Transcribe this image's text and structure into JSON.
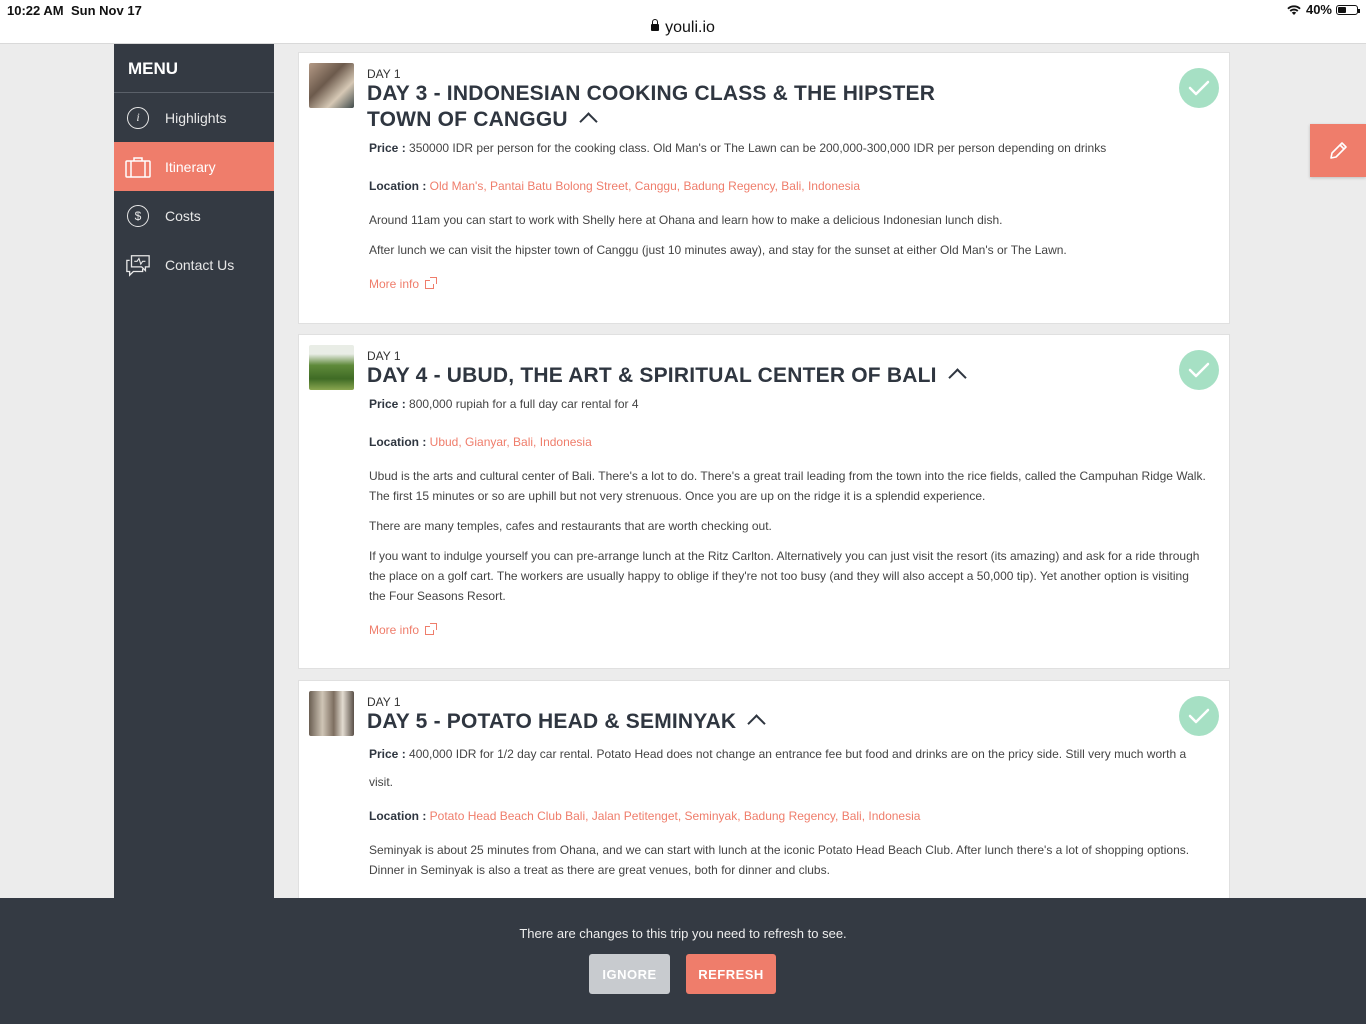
{
  "status": {
    "time": "10:22 AM",
    "date": "Sun Nov 17",
    "url": "youli.io",
    "battery": "40%"
  },
  "menu": {
    "title": "MENU",
    "items": [
      {
        "label": "Highlights",
        "icon": "info-icon"
      },
      {
        "label": "Itinerary",
        "icon": "suitcase-icon",
        "active": true
      },
      {
        "label": "Costs",
        "icon": "dollar-icon"
      },
      {
        "label": "Contact Us",
        "icon": "chat-icon"
      }
    ]
  },
  "cards": [
    {
      "day": "DAY 1",
      "title_line1": "DAY 3 - INDONESIAN COOKING CLASS & THE HIPSTER",
      "title_line2": "TOWN OF CANGGU",
      "price_label": "Price :",
      "price": "350000 IDR per person for the cooking class. Old Man's or The Lawn can be 200,000-300,000 IDR per person depending on drinks",
      "location_label": "Location :",
      "location": "Old Man's, Pantai Batu Bolong Street, Canggu, Badung Regency, Bali, Indonesia",
      "paragraphs": [
        "Around 11am you can start to work with Shelly here at Ohana and learn how to make a delicious Indonesian lunch dish.",
        "After lunch we can visit the hipster town of Canggu (just 10 minutes away), and stay for the sunset at either Old Man's or The Lawn."
      ],
      "more": "More info"
    },
    {
      "day": "DAY 1",
      "title_line1": "DAY 4 - UBUD, THE ART & SPIRITUAL CENTER OF BALI",
      "price_label": "Price :",
      "price": "800,000 rupiah for a full day car rental for 4",
      "location_label": "Location :",
      "location": "Ubud, Gianyar, Bali, Indonesia",
      "paragraphs": [
        "Ubud is the arts and cultural center of Bali. There's a lot to do. There's a great trail leading from the town into the rice fields, called the Campuhan Ridge Walk. The first 15 minutes or so are uphill but not very strenuous. Once you are up on the ridge it is a splendid experience.",
        "There are many temples, cafes and restaurants that are worth checking out.",
        "If you want to indulge yourself you can pre-arrange lunch at the Ritz Carlton. Alternatively you can just visit the resort (its amazing) and ask for a ride through the place on a golf cart. The workers are usually happy to oblige if they're not too busy (and they will also accept a 50,000 tip). Yet another option is visiting the Four Seasons Resort."
      ],
      "more": "More info"
    },
    {
      "day": "DAY 1",
      "title_line1": "DAY 5 - POTATO HEAD & SEMINYAK",
      "price_label": "Price :",
      "price": "400,000 IDR for 1/2 day car rental. Potato Head does not change an entrance fee but food and drinks are on the pricy side. Still very much worth a visit.",
      "location_label": "Location :",
      "location": "Potato Head Beach Club Bali, Jalan Petitenget, Seminyak, Badung Regency, Bali, Indonesia",
      "paragraphs": [
        "Seminyak is about 25 minutes from Ohana, and we can start with lunch at the iconic Potato Head Beach Club. After lunch there's a lot of shopping options. Dinner in Seminyak is also a treat as there are great venues, both for dinner and clubs."
      ]
    }
  ],
  "banner": {
    "message": "There are changes to this trip you need to refresh to see.",
    "ignore": "IGNORE",
    "refresh": "REFRESH"
  },
  "colors": {
    "accent": "#ef7d6b",
    "sidebar": "#343a43",
    "check": "#a6e0c4"
  }
}
